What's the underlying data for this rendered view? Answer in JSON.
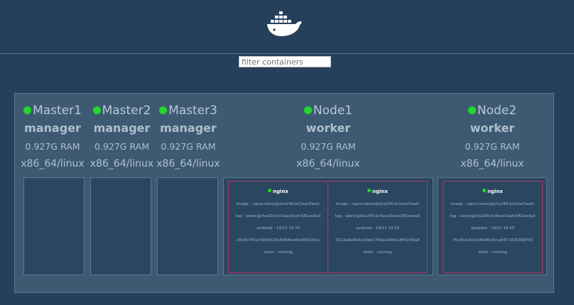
{
  "header": {
    "logo_icon": "docker-whale-icon"
  },
  "filter": {
    "placeholder": "filter containers",
    "value": ""
  },
  "colors": {
    "background": "#25405a",
    "panel": "#3e5a72",
    "status_running": "#21d928",
    "container_border": "#b03565"
  },
  "nodes": [
    {
      "name": "Master1",
      "role": "manager",
      "ram": "0.927G RAM",
      "os": "x86_64/linux"
    },
    {
      "name": "Master2",
      "role": "manager",
      "ram": "0.927G RAM",
      "os": "x86_64/linux"
    },
    {
      "name": "Master3",
      "role": "manager",
      "ram": "0.927G RAM",
      "os": "x86_64/linux"
    },
    {
      "name": "Node1",
      "role": "worker",
      "ram": "0.927G RAM",
      "os": "x86_64/linux",
      "containers": [
        {
          "name": "nginx",
          "image": "image : nginx:latest@sha256:bc5eac5eafc",
          "tag": "tag : latest@sha256:bc5eac5eafc581aeda3",
          "updated": "updated : 19/11 19:55",
          "id": "c9c95705a70046720c8068ee4dc8f019e1c",
          "state": "state : running"
        },
        {
          "name": "nginx",
          "image": "image : nginx:latest@sha256:bc5eac5eafc",
          "tag": "tag : latest@sha256:bc5eac5eafc581aeda3",
          "updated": "updated : 19/11 19:55",
          "id": "0323a9e404e14e6276daa648a180f1f35a8",
          "state": "state : running"
        }
      ]
    },
    {
      "name": "Node2",
      "role": "worker",
      "ram": "0.927G RAM",
      "os": "x86_64/linux",
      "containers": [
        {
          "name": "nginx",
          "image": "image : nginx:latest@sha256:bc5eac5eafc",
          "tag": "tag : latest@sha256:bc5eac5eafc581aeda3",
          "updated": "updated : 19/11 19:55",
          "id": "76cd02a5d1d36d8c81ca6471025398763",
          "state": "state : running"
        }
      ]
    }
  ]
}
